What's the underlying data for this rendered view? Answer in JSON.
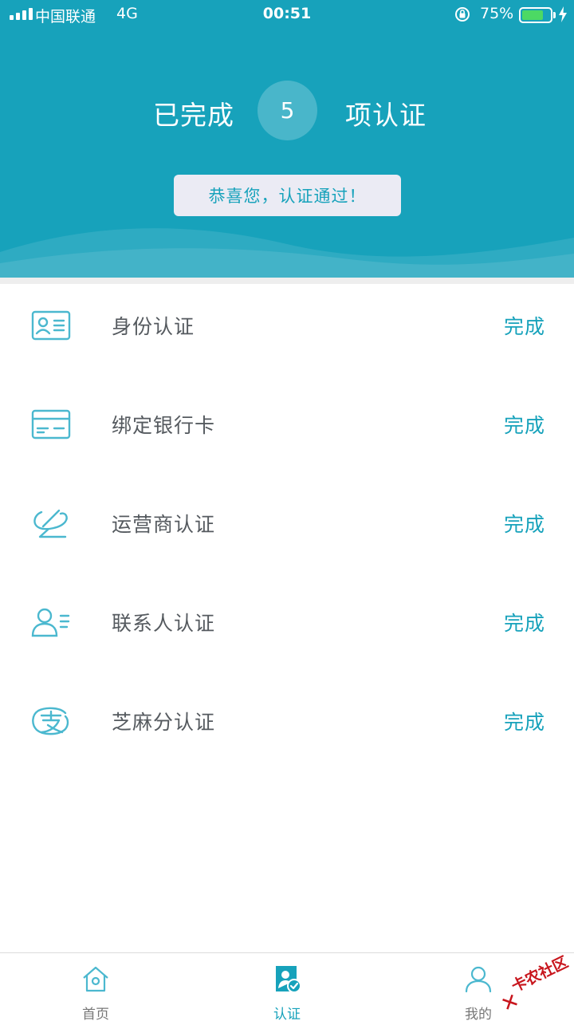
{
  "status_bar": {
    "carrier": "中国联通",
    "network": "4G",
    "time": "00:51",
    "battery_percent": "75%",
    "battery_level": 0.75,
    "battery_color": "#4cd964"
  },
  "header": {
    "prefix": "已完成",
    "count": "5",
    "suffix": "项认证",
    "congrats": "恭喜您，认证通过！",
    "bg_color": "#17a2bb"
  },
  "auth_items": [
    {
      "icon": "id-card-icon",
      "label": "身份认证",
      "status": "完成"
    },
    {
      "icon": "bank-card-icon",
      "label": "绑定银行卡",
      "status": "完成"
    },
    {
      "icon": "operator-icon",
      "label": "运营商认证",
      "status": "完成"
    },
    {
      "icon": "contacts-icon",
      "label": "联系人认证",
      "status": "完成"
    },
    {
      "icon": "alipay-icon",
      "label": "芝麻分认证",
      "status": "完成"
    }
  ],
  "tabs": [
    {
      "icon": "home-icon",
      "label": "首页",
      "active": false
    },
    {
      "icon": "verify-icon",
      "label": "认证",
      "active": true
    },
    {
      "icon": "user-icon",
      "label": "我的",
      "active": false
    }
  ],
  "watermark": {
    "text": "卡农社区"
  }
}
